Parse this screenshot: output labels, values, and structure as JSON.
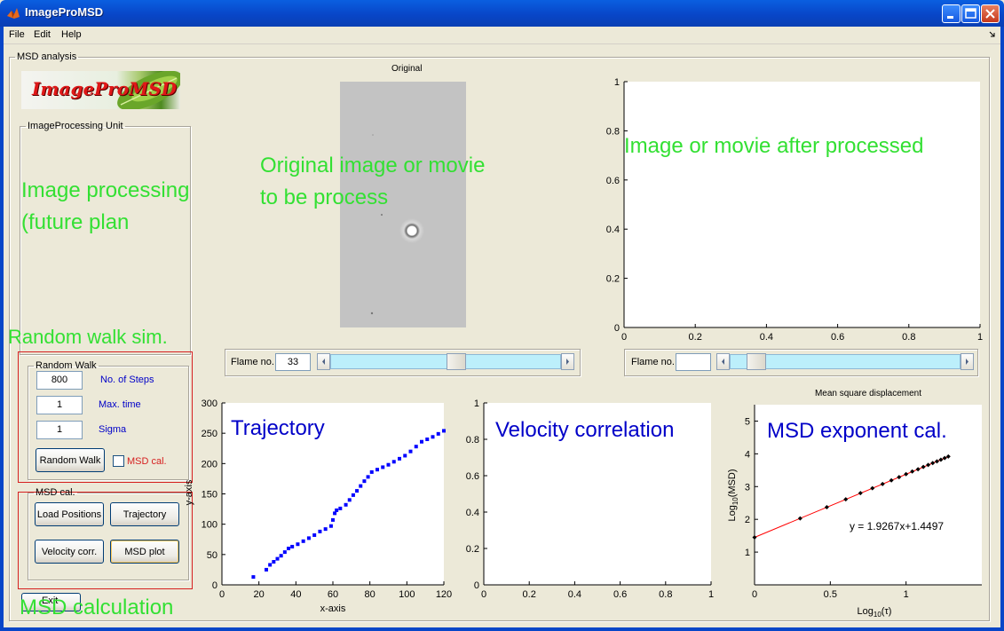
{
  "window": {
    "title": "ImageProMSD"
  },
  "menu": [
    "File",
    "Edit",
    "Help"
  ],
  "main_panel_title": "MSD analysis",
  "logo_text": "ImageProMSD",
  "image_processing_panel": {
    "title": "ImageProcessing Unit",
    "note": "Image processing\n(future plan"
  },
  "original": {
    "title": "Original",
    "note": "Original image or movie\nto be process",
    "frame_label": "Flame no.",
    "frame_value": "33",
    "slider_position": 0.55
  },
  "processed": {
    "note": "Image or movie after processed",
    "frame_label": "Flame no.",
    "frame_value": "",
    "slider_position": 0.08
  },
  "random_walk": {
    "annotation": "Random walk sim.",
    "title": "Random Walk",
    "steps_value": "800",
    "steps_label": "No. of Steps",
    "maxtime_value": "1",
    "maxtime_label": "Max. time",
    "sigma_value": "1",
    "sigma_label": "Sigma",
    "button": "Random Walk",
    "msd_checkbox_label": "MSD cal.",
    "msd_checked": false
  },
  "msd_cal": {
    "annotation": "MSD calculation",
    "title": "MSD cal.",
    "load_button": "Load Positions",
    "trajectory_button": "Trajectory",
    "velocity_button": "Velocity corr.",
    "msd_plot_button": "MSD plot",
    "exit_button": "Exit"
  },
  "colors": {
    "annotation_green": "#33e033",
    "annotation_blue": "#0000c8",
    "box_red": "#d62020",
    "trajectory_points": "#0000ff",
    "fit_line": "#ff0000"
  },
  "chart_data": [
    {
      "type": "line",
      "id": "processed-axes",
      "xlim": [
        0,
        1
      ],
      "ylim": [
        0,
        1
      ],
      "x_ticks": [
        "0",
        "0.2",
        "0.4",
        "0.6",
        "0.8",
        "1"
      ],
      "y_ticks": [
        "0",
        "0.2",
        "0.4",
        "0.6",
        "0.8",
        "1"
      ],
      "series": []
    },
    {
      "type": "scatter",
      "id": "trajectory",
      "annotation": "Trajectory",
      "xlabel": "x-axis",
      "ylabel": "y-axis",
      "xlim": [
        0,
        120
      ],
      "ylim": [
        0,
        300
      ],
      "x_ticks": [
        "0",
        "20",
        "40",
        "60",
        "80",
        "100",
        "120"
      ],
      "y_ticks": [
        "0",
        "50",
        "100",
        "150",
        "200",
        "250",
        "300"
      ],
      "x": [
        17,
        24,
        26,
        28,
        30,
        32,
        34,
        36,
        38,
        41,
        44,
        47,
        50,
        53,
        56,
        59,
        60,
        61,
        62,
        64,
        67,
        69,
        71,
        73,
        75,
        77,
        79,
        81,
        84,
        87,
        90,
        93,
        96,
        99,
        102,
        105,
        108,
        111,
        114,
        117,
        120
      ],
      "y": [
        13,
        25,
        33,
        38,
        43,
        48,
        54,
        60,
        63,
        67,
        72,
        77,
        82,
        88,
        92,
        97,
        107,
        118,
        123,
        126,
        132,
        140,
        148,
        155,
        163,
        171,
        178,
        186,
        190,
        194,
        198,
        203,
        208,
        213,
        220,
        228,
        236,
        240,
        244,
        249,
        254
      ]
    },
    {
      "type": "line",
      "id": "velocity-correlation",
      "annotation": "Velocity correlation",
      "xlim": [
        0,
        1
      ],
      "ylim": [
        0,
        1
      ],
      "x_ticks": [
        "0",
        "0.2",
        "0.4",
        "0.6",
        "0.8",
        "1"
      ],
      "y_ticks": [
        "0",
        "0.2",
        "0.4",
        "0.6",
        "0.8",
        "1"
      ],
      "series": []
    },
    {
      "type": "scatter",
      "id": "msd",
      "title": "Mean square displacement",
      "annotation": "MSD exponent cal.",
      "xlabel_base": "Log",
      "xlabel_sub": "10",
      "xlabel_arg": "(τ)",
      "ylabel_base": "Log",
      "ylabel_sub": "10",
      "ylabel_arg": "(MSD)",
      "xlim": [
        0,
        1.5
      ],
      "ylim": [
        0,
        5.5
      ],
      "x_ticks": [
        "0",
        "0.5",
        "1"
      ],
      "x_tick_values": [
        0,
        0.5,
        1
      ],
      "y_ticks": [
        "1",
        "2",
        "3",
        "4",
        "5"
      ],
      "y_tick_values": [
        1,
        2,
        3,
        4,
        5
      ],
      "x": [
        0,
        0.301,
        0.477,
        0.602,
        0.699,
        0.778,
        0.845,
        0.903,
        0.954,
        1.0,
        1.041,
        1.079,
        1.114,
        1.146,
        1.176,
        1.204,
        1.23,
        1.255,
        1.279
      ],
      "y": [
        1.45,
        2.03,
        2.37,
        2.61,
        2.8,
        2.95,
        3.08,
        3.19,
        3.29,
        3.38,
        3.46,
        3.53,
        3.6,
        3.66,
        3.72,
        3.77,
        3.82,
        3.87,
        3.92
      ],
      "fit": {
        "slope": 1.9267,
        "intercept": 1.4497,
        "label": "y = 1.9267x+1.4497"
      }
    }
  ]
}
